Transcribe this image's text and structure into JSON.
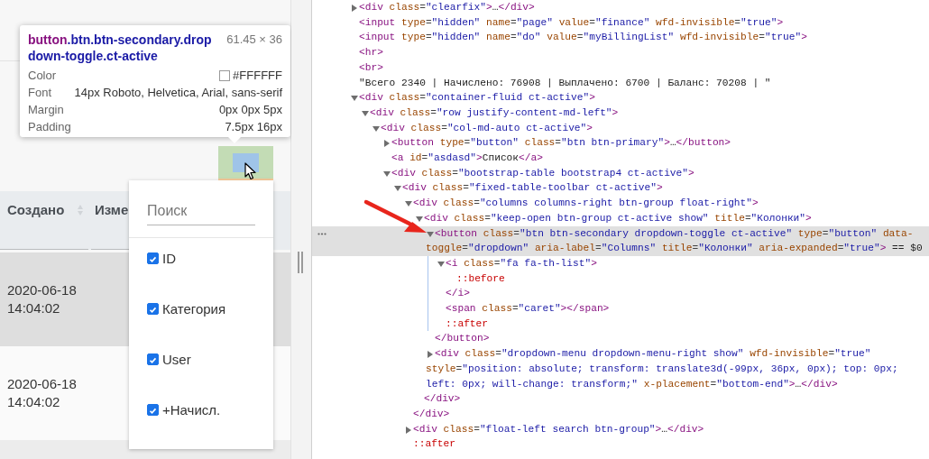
{
  "page_preview": {
    "table": {
      "columns": [
        {
          "label": "Создано",
          "sortable": true
        },
        {
          "label": "Изме",
          "sortable": false
        }
      ],
      "rows": [
        {
          "cells": [
            "2020-06-18 14:04:02"
          ]
        },
        {
          "cells": [
            "2020-06-18 14:04:02"
          ]
        }
      ]
    },
    "columns_menu": {
      "search": {
        "placeholder": "Поиск"
      },
      "items": [
        {
          "label": "ID",
          "checked": true
        },
        {
          "label": "Категория",
          "checked": true
        },
        {
          "label": "User",
          "checked": true
        },
        {
          "label": "+Начисл.",
          "checked": true
        }
      ]
    }
  },
  "inspect_tooltip": {
    "tag": "button",
    "classes": ".btn.btn-secondary.dropdown-toggle.ct-active",
    "size": "61.45 × 36",
    "rows": [
      {
        "label": "Color",
        "value": "#FFFFFF",
        "kind": "color"
      },
      {
        "label": "Font",
        "value": "14px Roboto, Helvetica, Arial, sans-serif",
        "kind": "text"
      },
      {
        "label": "Margin",
        "value": "0px 0px 5px",
        "kind": "text"
      },
      {
        "label": "Padding",
        "value": "7.5px 16px",
        "kind": "text"
      }
    ]
  },
  "elements_tree": [
    {
      "markup": "<div class=\"clearfix\">…</div>",
      "selected": false,
      "expanded": false
    },
    {
      "markup": "<input type=\"hidden\" name=\"page\" value=\"finance\" wfd-invisible=\"true\">",
      "selected": false
    },
    {
      "markup": "<input type=\"hidden\" name=\"do\" value=\"myBillingList\" wfd-invisible=\"true\">",
      "selected": false
    },
    {
      "markup": "<hr>",
      "selected": false
    },
    {
      "markup": "<br>",
      "selected": false
    },
    {
      "markup": "\"Всего 2340 | Начислено: 76908 | Выплачено: 6700 | Баланс: 70208 | \"",
      "selected": false
    },
    {
      "markup": "<div class=\"container-fluid ct-active\">",
      "selected": false,
      "expanded": true,
      "children": [
        {
          "markup": "<div class=\"row justify-content-md-left\">",
          "selected": false,
          "expanded": true,
          "children": [
            {
              "markup": "<div class=\"col-md-auto ct-active\">",
              "selected": false,
              "expanded": true,
              "children": [
                {
                  "markup": "<button type=\"button\" class=\"btn btn-primary\">…</button>",
                  "selected": false,
                  "expanded": false
                },
                {
                  "markup": "<a id=\"asdasd\">Список</a>",
                  "selected": false
                },
                {
                  "markup": "<div class=\"bootstrap-table bootstrap4 ct-active\">",
                  "selected": false,
                  "expanded": true,
                  "children": [
                    {
                      "markup": "<div class=\"fixed-table-toolbar ct-active\">",
                      "selected": false,
                      "expanded": true,
                      "children": [
                        {
                          "markup": "<div class=\"columns columns-right btn-group float-right\">",
                          "selected": false,
                          "expanded": true,
                          "close": "</div>",
                          "children": [
                            {
                              "markup": "<div class=\"keep-open btn-group ct-active show\" title=\"Колонки\">",
                              "selected": false,
                              "expanded": true,
                              "close": "</div>",
                              "children": [
                                {
                                  "markup": "<button class=\"btn btn-secondary dropdown-toggle ct-active\" type=\"button\" data-toggle=\"dropdown\" aria-label=\"Columns\" title=\"Колонки\" aria-expanded=\"true\"> == $0",
                                  "selected": true,
                                  "expanded": true,
                                  "close": "</button>",
                                  "children": [
                                    {
                                      "markup": "<i class=\"fa fa-th-list\">",
                                      "selected": false,
                                      "expanded": true,
                                      "close": "</i>",
                                      "children": [
                                        {
                                          "markup": "::before",
                                          "selected": false
                                        }
                                      ]
                                    },
                                    {
                                      "markup": "<span class=\"caret\"></span>",
                                      "selected": false
                                    },
                                    {
                                      "markup": "::after",
                                      "selected": false
                                    }
                                  ]
                                },
                                {
                                  "markup": "<div class=\"dropdown-menu dropdown-menu-right show\" wfd-invisible=\"true\" style=\"position: absolute; transform: translate3d(-99px, 36px, 0px); top: 0px; left: 0px; will-change: transform;\" x-placement=\"bottom-end\">…</div>",
                                  "selected": false,
                                  "expanded": false
                                }
                              ]
                            }
                          ]
                        },
                        {
                          "markup": "<div class=\"float-left search btn-group\">…</div>",
                          "selected": false,
                          "expanded": false
                        },
                        {
                          "markup": "::after",
                          "selected": false
                        }
                      ]
                    }
                  ]
                }
              ]
            }
          ]
        }
      ]
    }
  ]
}
